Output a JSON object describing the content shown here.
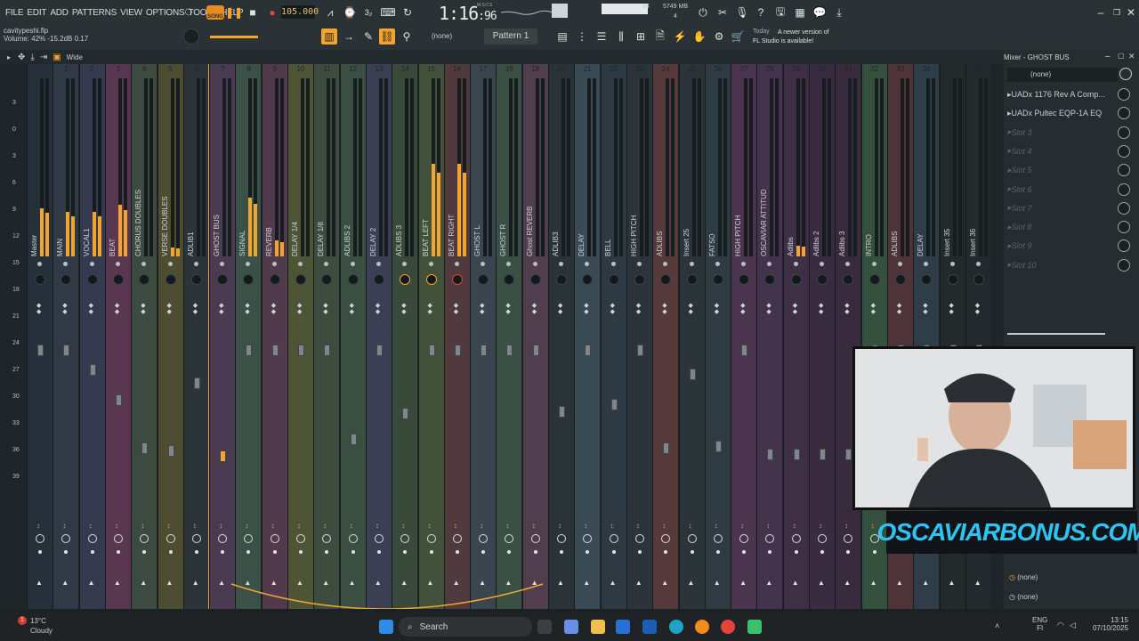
{
  "menubar": {
    "menus": [
      "FILE",
      "EDIT",
      "ADD",
      "PATTERNS",
      "VIEW",
      "OPTIONS",
      "TOOLS",
      "HELP"
    ],
    "song_badge": "SONG",
    "tempo": "105.000",
    "time": "1:16",
    "time_frac": ":96",
    "msc": "M:S:CS",
    "memory": "5749 MB",
    "cpu_polyphony": "84",
    "cpu_num": "4"
  },
  "infobar": {
    "project": "cavitypeshi.flp",
    "status": "Volume: 42%  -15.2dB  0.17"
  },
  "toolbar2": {
    "pattern": "Pattern 1",
    "none_label": "(none)",
    "update_today": "Today",
    "update_text": "A newer version of FL Studio is available!"
  },
  "mixerbar": {
    "layout_label": "Wide"
  },
  "scale": [
    "3",
    "0",
    "3",
    "6",
    "9",
    "12",
    "15",
    "18",
    "21",
    "24",
    "27",
    "30",
    "33",
    "36",
    "39"
  ],
  "strips": [
    {
      "num": "",
      "name": "Master",
      "color": "#26303a",
      "level": 0.27,
      "fader": 0.05
    },
    {
      "num": "1",
      "name": "MAIN",
      "color": "#2f3a46",
      "level": 0.25,
      "fader": 0.05
    },
    {
      "num": "2",
      "name": "VOCAL1",
      "color": "#363a4e",
      "level": 0.25,
      "fader": 0.18
    },
    {
      "num": "3",
      "name": "BEAT",
      "color": "#5a3750",
      "level": 0.29,
      "fader": 0.38
    },
    {
      "num": "4",
      "name": "CHORUS DOUBLES",
      "color": "#3d4a40",
      "level": 0,
      "fader": 0.7
    },
    {
      "num": "5",
      "name": "VERSE DOUBLES",
      "color": "#4e4d32",
      "level": 0.05,
      "fader": 0.72
    },
    {
      "num": "6",
      "name": "ADLIB1",
      "color": "#2b3438",
      "level": 0,
      "fader": 0.27
    },
    {
      "num": "7",
      "name": "GHOST BUS",
      "color": "#4b3b52",
      "level": 0,
      "fader": 0.7
    },
    {
      "num": "8",
      "name": "SIGNAL",
      "color": "#3b5047",
      "level": 0.33,
      "fader": 0.05
    },
    {
      "num": "9",
      "name": "REVERB",
      "color": "#513a4b",
      "level": 0.09,
      "fader": 0.05
    },
    {
      "num": "10",
      "name": "DELAY 1/4",
      "color": "#4e5436",
      "level": 0,
      "fader": 0.05
    },
    {
      "num": "11",
      "name": "DELAY 1/8",
      "color": "#3e4c3f",
      "level": 0,
      "fader": 0.05
    },
    {
      "num": "12",
      "name": "ADLIBS 2",
      "color": "#3a4e42",
      "level": 0,
      "fader": 0.64
    },
    {
      "num": "13",
      "name": "DELAY 2",
      "color": "#3b3f54",
      "level": 0,
      "fader": 0.05
    },
    {
      "num": "14",
      "name": "ADLIBS 3",
      "color": "#394a3a",
      "level": 0,
      "fader": 0.47
    },
    {
      "num": "15",
      "name": "BEAT LEFT",
      "color": "#42523a",
      "level": 0.52,
      "fader": 0.05
    },
    {
      "num": "16",
      "name": "BEAT RIGHT",
      "color": "#503a3e",
      "level": 0.52,
      "fader": 0.05
    },
    {
      "num": "17",
      "name": "GHOST L",
      "color": "#3a4550",
      "level": 0,
      "fader": 0.05
    },
    {
      "num": "18",
      "name": "GHOST R",
      "color": "#3b5045",
      "level": 0,
      "fader": 0.05
    },
    {
      "num": "19",
      "name": "Ghost REVERB",
      "color": "#503d4d",
      "level": 0,
      "fader": 0.05
    },
    {
      "num": "20",
      "name": "ADLIB3",
      "color": "#2a3338",
      "level": 0,
      "fader": 0.46
    },
    {
      "num": "21",
      "name": "DELAY",
      "color": "#3a4a55",
      "level": 0,
      "fader": 0.05
    },
    {
      "num": "22",
      "name": "BELL",
      "color": "#2d3a44",
      "level": 0,
      "fader": 0.41
    },
    {
      "num": "23",
      "name": "HIGH PITCH",
      "color": "#2a343a",
      "level": 0,
      "fader": 0.05
    },
    {
      "num": "24",
      "name": "ADLIBS",
      "color": "#56393b",
      "level": 0,
      "fader": 0.7
    },
    {
      "num": "25",
      "name": "Insert 25",
      "color": "#2b3438",
      "level": 0,
      "fader": 0.21
    },
    {
      "num": "26",
      "name": "FATSO",
      "color": "#2f3b42",
      "level": 0,
      "fader": 0.69
    },
    {
      "num": "27",
      "name": "HIGH PITCH",
      "color": "#4a344e",
      "level": 0,
      "fader": 0.05
    },
    {
      "num": "28",
      "name": "OSCAVIAR ATTITUDE",
      "color": "#43334c",
      "level": 0,
      "fader": 0.74
    },
    {
      "num": "29",
      "name": "Adlibs",
      "color": "#3f2f46",
      "level": 0.06,
      "fader": 0.74
    },
    {
      "num": "30",
      "name": "Adlibs 2",
      "color": "#3a2c40",
      "level": 0,
      "fader": 0.74
    },
    {
      "num": "31",
      "name": "Adlibs 3",
      "color": "#382b3e",
      "level": 0,
      "fader": 0.74
    },
    {
      "num": "32",
      "name": "INTRO",
      "color": "#35503c",
      "level": 0,
      "fader": 0.05
    },
    {
      "num": "33",
      "name": "ADLIBS",
      "color": "#4e3438",
      "level": 0,
      "fader": 0.05
    },
    {
      "num": "34",
      "name": "DELAY",
      "color": "#2e3d48",
      "level": 0,
      "fader": 0.05
    },
    {
      "num": "35",
      "name": "Insert 35",
      "color": "#232a2e",
      "level": 0,
      "fader": 0.05
    },
    {
      "num": "36",
      "name": "Insert 36",
      "color": "#232a2e",
      "level": 0,
      "fader": 0.05
    }
  ],
  "panel": {
    "title": "Mixer - GHOST BUS",
    "preset": "(none)",
    "slots": [
      "UADx 1176 Rev A Comp...",
      "UADx Pultec EQP-1A EQ",
      "Slot 3",
      "Slot 4",
      "Slot 5",
      "Slot 6",
      "Slot 7",
      "Slot 8",
      "Slot 9",
      "Slot 10"
    ],
    "eq_none_1": "(none)",
    "eq_none_2": "(none)"
  },
  "brand": {
    "text": "OSCAVIARBONUS.COM"
  },
  "taskbar": {
    "weather_temp": "13°C",
    "weather_desc": "Cloudy",
    "weather_badge": "1",
    "search": "Search",
    "lang": "ENG",
    "lang2": "FI",
    "time": "13:15",
    "date": "07/10/2025"
  },
  "colors": {
    "accent": "#f2a42e",
    "bg": "#1f2528"
  }
}
